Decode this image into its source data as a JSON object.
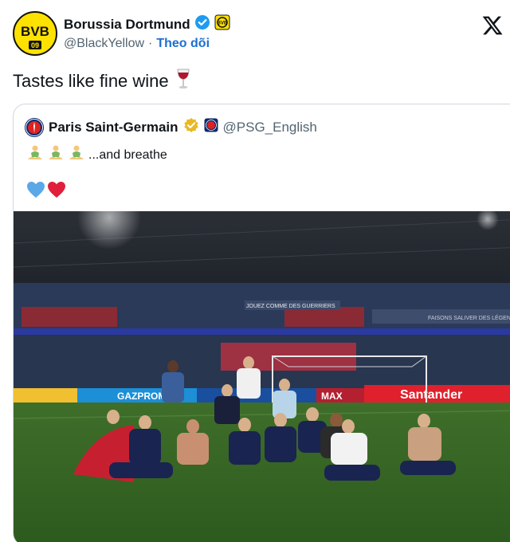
{
  "tweet": {
    "author": {
      "name": "Borussia Dortmund",
      "handle": "@BlackYellow",
      "separator": "·",
      "follow_label": "Theo dõi",
      "logo_text": "BVB",
      "logo_sub": "09"
    },
    "text": "Tastes like fine wine",
    "text_emoji": "wine-glass-icon",
    "colors": {
      "verified": "#1d9bf0",
      "gold_verified": "#e8b923",
      "follow": "#1d6fcf",
      "bvb_yellow": "#fde100"
    }
  },
  "quoted": {
    "author": {
      "name": "Paris Saint-Germain",
      "handle": "@PSG_English"
    },
    "line1_text": "...and breathe",
    "line1_emojis": [
      "person-in-lotus-position-icon",
      "person-in-lotus-position-icon",
      "person-in-lotus-position-icon"
    ],
    "line2_emojis": [
      "blue-heart-icon",
      "red-heart-icon"
    ],
    "photo": {
      "banner_left": "GAZPROM",
      "banner_right": "Santander",
      "banner_mid": "MAX",
      "stand_text": "JOUEZ COMME DES GUERRIERS",
      "upper_text": "FAISONS SALIVER DES LÉGENDES"
    }
  }
}
